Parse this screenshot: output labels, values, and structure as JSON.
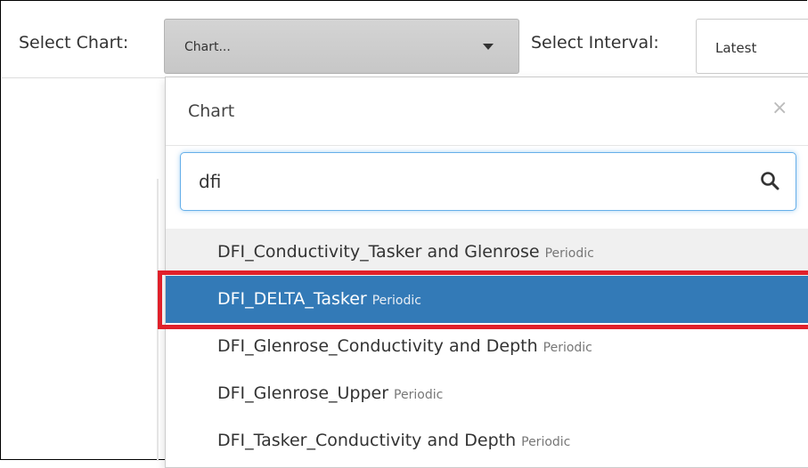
{
  "toolbar": {
    "chart_label": "Select Chart:",
    "chart_select_value": "Chart...",
    "interval_label": "Select Interval:",
    "interval_select_value": "Latest"
  },
  "dropdown": {
    "title": "Chart",
    "close_symbol": "×",
    "search_value": "dfi",
    "options": [
      {
        "name": "DFI_Conductivity_Tasker and Glenrose",
        "tag": "Periodic"
      },
      {
        "name": "DFI_DELTA_Tasker",
        "tag": "Periodic"
      },
      {
        "name": "DFI_Glenrose_Conductivity and Depth",
        "tag": "Periodic"
      },
      {
        "name": "DFI_Glenrose_Upper",
        "tag": "Periodic"
      },
      {
        "name": "DFI_Tasker_Conductivity and Depth",
        "tag": "Periodic"
      }
    ]
  },
  "colors": {
    "selected_bg": "#337ab7",
    "highlight_border": "#e0202a",
    "focus_border": "#66afe9"
  },
  "icons": {
    "search": "search-icon",
    "close": "close-icon",
    "caret": "caret-down-icon"
  }
}
